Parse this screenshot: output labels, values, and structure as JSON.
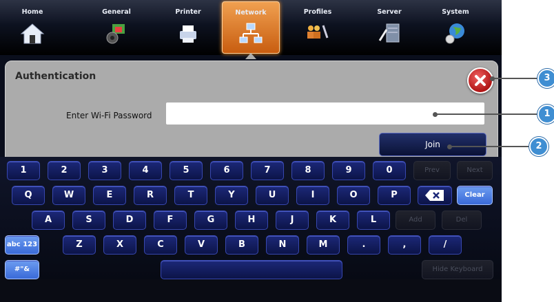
{
  "nav": {
    "items": [
      {
        "label": "Home",
        "icon": "home-icon"
      },
      {
        "label": "General",
        "icon": "general-icon"
      },
      {
        "label": "Printer",
        "icon": "printer-icon"
      },
      {
        "label": "Network",
        "icon": "network-icon",
        "active": true
      },
      {
        "label": "Profiles",
        "icon": "profiles-icon"
      },
      {
        "label": "Server",
        "icon": "server-icon"
      },
      {
        "label": "System",
        "icon": "system-icon"
      }
    ]
  },
  "dialog": {
    "title": "Authentication",
    "password_label": "Enter Wi-Fi Password",
    "password_value": "",
    "join_label": "Join"
  },
  "keyboard": {
    "row1": [
      "1",
      "2",
      "3",
      "4",
      "5",
      "6",
      "7",
      "8",
      "9",
      "0",
      "Prev",
      "Next"
    ],
    "row2": [
      "Q",
      "W",
      "E",
      "R",
      "T",
      "Y",
      "U",
      "I",
      "O",
      "P",
      "backspace",
      "Clear"
    ],
    "row3": [
      "A",
      "S",
      "D",
      "F",
      "G",
      "H",
      "J",
      "K",
      "L",
      "Add",
      "Del"
    ],
    "row4": [
      "abc 123",
      "Z",
      "X",
      "C",
      "V",
      "B",
      "N",
      "M",
      ".",
      ",",
      "/"
    ],
    "row5": [
      "#\"&",
      "space",
      "Hide Keyboard"
    ]
  },
  "callouts": [
    "1",
    "2",
    "3"
  ],
  "colors": {
    "accent": "#3f8ed2",
    "active_tab": "#e07a2a",
    "key_blue": "#1c2878",
    "close_red": "#c82020"
  }
}
